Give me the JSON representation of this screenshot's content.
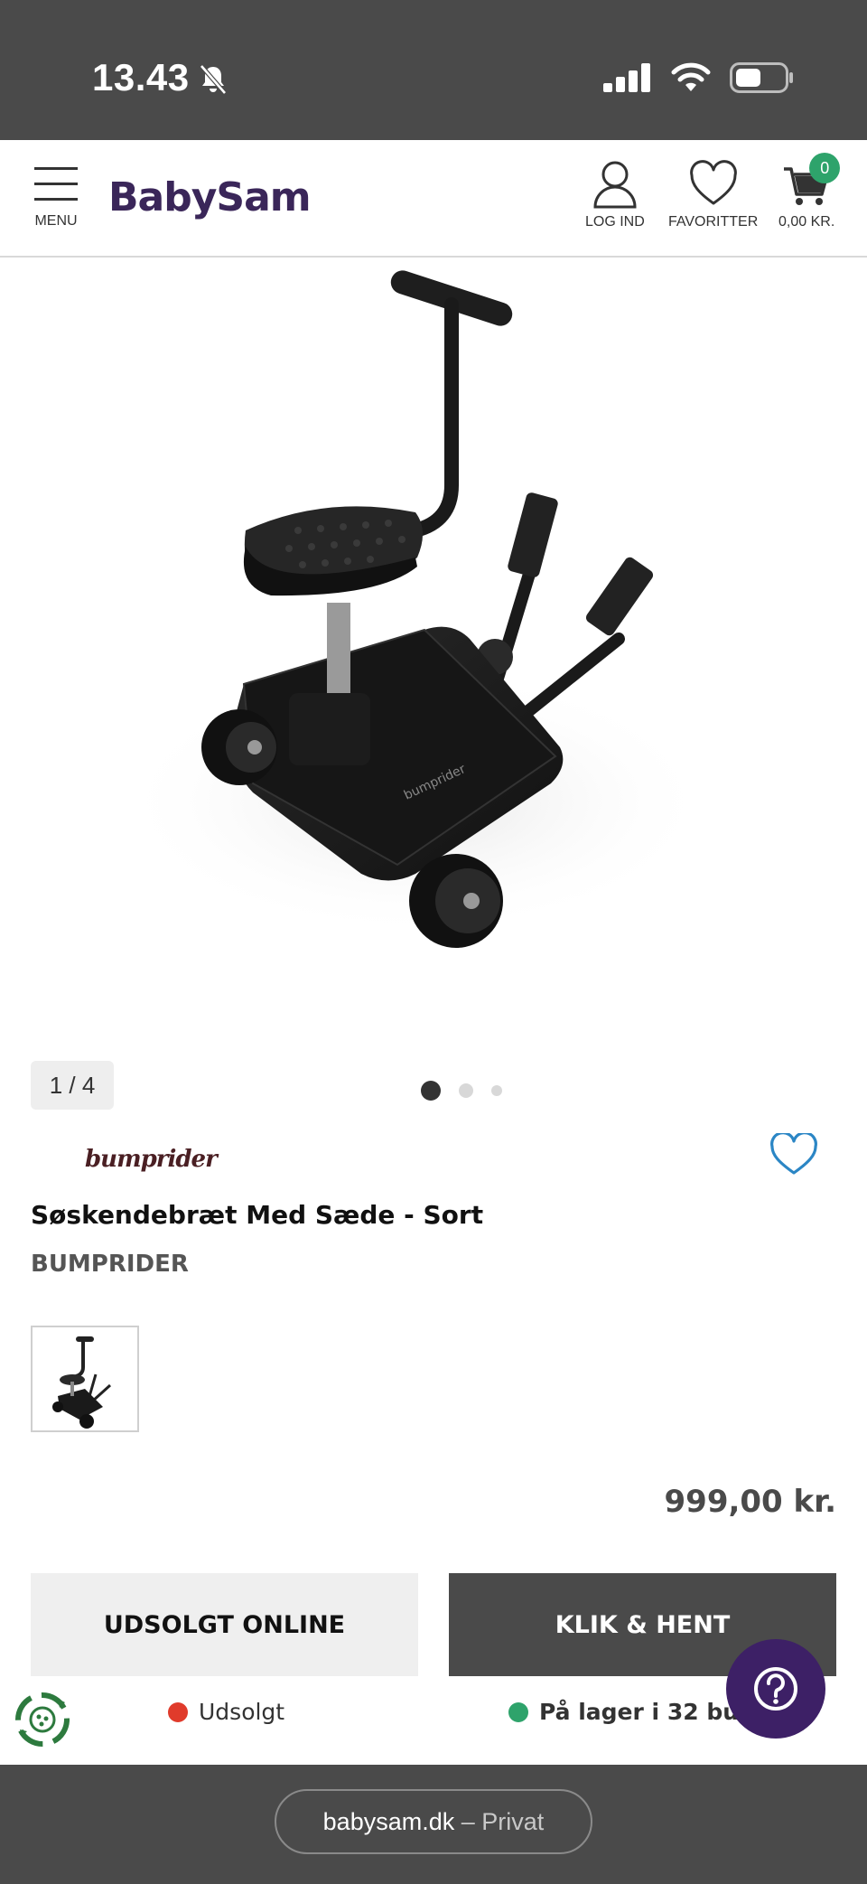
{
  "status_bar": {
    "time": "13.43"
  },
  "header": {
    "logo": "BabySam",
    "menu_label": "MENU",
    "login_label": "LOG IND",
    "favorites_label": "FAVORITTER",
    "cart_total": "0,00 KR.",
    "cart_count": "0"
  },
  "gallery": {
    "counter": "1 / 4",
    "dot_count": 3,
    "active_dot": 0
  },
  "product": {
    "brand_logo_text": "bumprider",
    "title": "Søskendebræt Med Sæde - Sort",
    "brand": "BUMPRIDER",
    "price": "999,00 kr."
  },
  "actions": {
    "sold_out_label": "UDSOLGT ONLINE",
    "click_collect_label": "KLIK & HENT"
  },
  "availability": {
    "online_status": "Udsolgt",
    "store_status": "På lager i 32 butikker"
  },
  "browser": {
    "domain": "babysam.dk",
    "separator": "–",
    "mode": "Privat"
  },
  "colors": {
    "brand_purple": "#3a2659",
    "sold_out_red": "#e03b2b",
    "in_stock_green": "#2ea36b",
    "heart_blue": "#2b86c5",
    "help_purple": "#3d2066"
  },
  "icons": [
    "bell-slash-icon",
    "signal-icon",
    "wifi-icon",
    "battery-icon",
    "menu-icon",
    "user-icon",
    "heart-icon",
    "cart-icon",
    "recycle-icon",
    "help-icon"
  ]
}
